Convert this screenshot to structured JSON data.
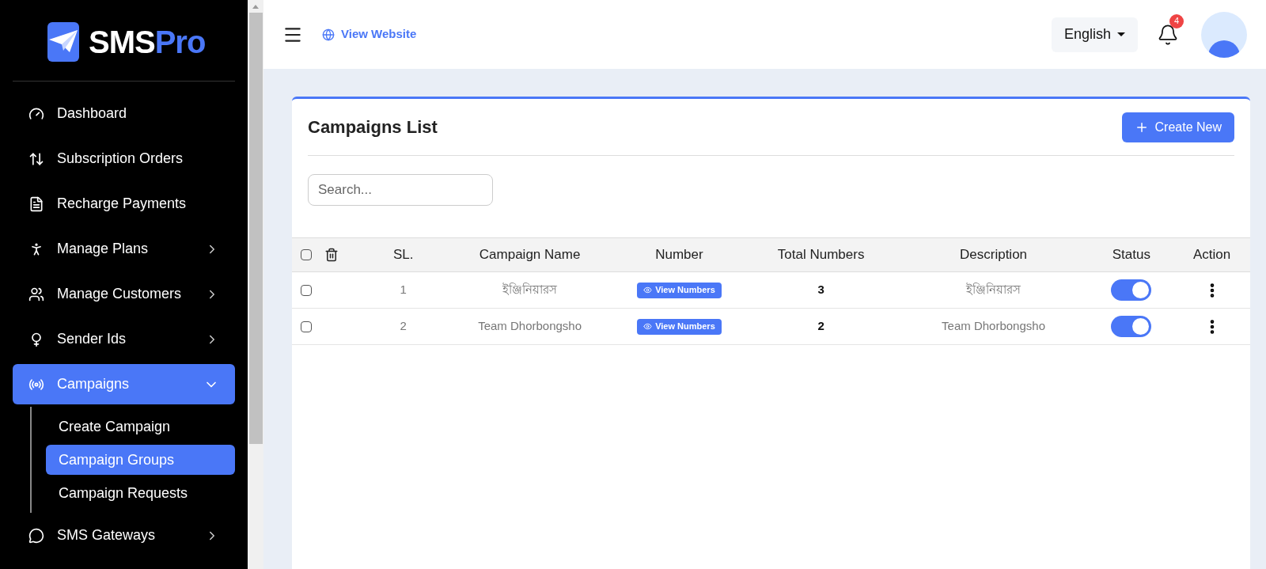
{
  "logo": {
    "text_main": "SMS",
    "text_accent": "Pro"
  },
  "sidebar": {
    "items": [
      {
        "label": "Dashboard",
        "has_arrow": false,
        "selected": false
      },
      {
        "label": "Subscription Orders",
        "has_arrow": false,
        "selected": false
      },
      {
        "label": "Recharge Payments",
        "has_arrow": false,
        "selected": false
      },
      {
        "label": "Manage Plans",
        "has_arrow": true,
        "expanded": false,
        "selected": false
      },
      {
        "label": "Manage Customers",
        "has_arrow": true,
        "expanded": false,
        "selected": false
      },
      {
        "label": "Sender Ids",
        "has_arrow": true,
        "expanded": false,
        "selected": false
      },
      {
        "label": "Campaigns",
        "has_arrow": true,
        "expanded": true,
        "selected": true,
        "children": [
          {
            "label": "Create Campaign",
            "selected": false
          },
          {
            "label": "Campaign Groups",
            "selected": true
          },
          {
            "label": "Campaign Requests",
            "selected": false
          }
        ]
      },
      {
        "label": "SMS Gateways",
        "has_arrow": true,
        "expanded": false,
        "selected": false
      }
    ]
  },
  "header": {
    "view_website": "View Website",
    "language": "English",
    "notifications": "4"
  },
  "card": {
    "title": "Campaigns List",
    "create_button": "Create New",
    "search": {
      "placeholder": "Search..."
    },
    "table": {
      "all_checked": false,
      "columns": [
        "SL.",
        "Campaign Name",
        "Number",
        "Total Numbers",
        "Description",
        "Status",
        "Action"
      ],
      "rows": [
        {
          "checked": false,
          "sl": "1",
          "name": "ইঞ্জিনিয়ারস",
          "number_button": "View Numbers",
          "total": "3",
          "description": "ইঞ্জিনিয়ারস",
          "on": true
        },
        {
          "checked": false,
          "sl": "2",
          "name": "Team Dhorbongsho",
          "number_button": "View Numbers",
          "total": "2",
          "description": "Team Dhorbongsho",
          "on": true
        }
      ]
    }
  }
}
